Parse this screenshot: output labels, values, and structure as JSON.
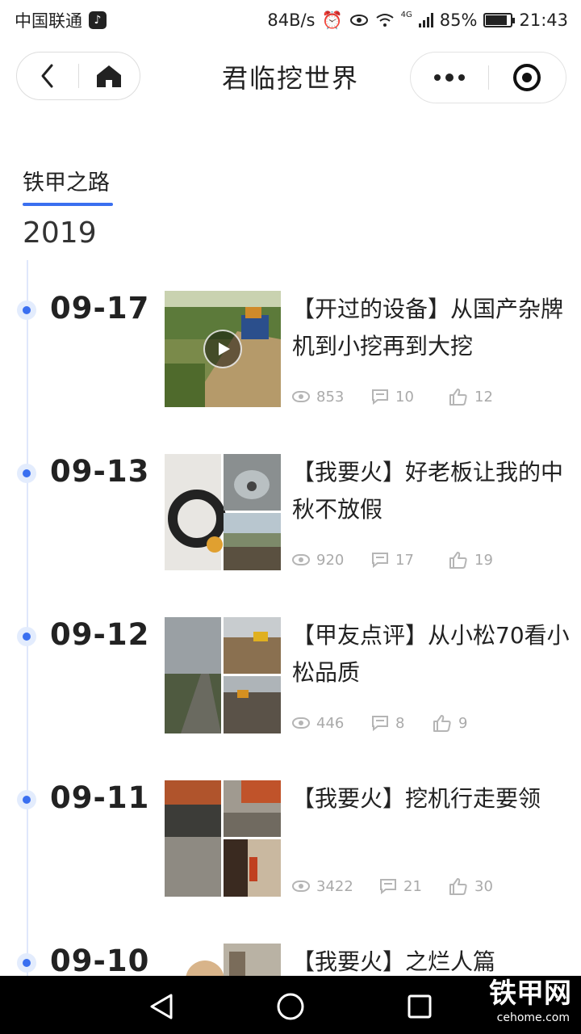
{
  "status_bar": {
    "carrier": "中国联通",
    "net_speed": "84B/s",
    "network": "4G",
    "battery": "85%",
    "battery_level": 0.85,
    "time": "21:43"
  },
  "nav": {
    "title": "君临挖世界"
  },
  "tabs": [
    {
      "label": "铁甲之路",
      "active": true
    }
  ],
  "year": "2019",
  "entries": [
    {
      "date": "09-17",
      "title": "【开过的设备】从国产杂牌机到小挖再到大挖",
      "views": "853",
      "comments": "10",
      "likes": "12",
      "has_video": true
    },
    {
      "date": "09-13",
      "title": "【我要火】好老板让我的中秋不放假",
      "views": "920",
      "comments": "17",
      "likes": "19",
      "has_video": false
    },
    {
      "date": "09-12",
      "title": "【甲友点评】从小松70看小松品质",
      "views": "446",
      "comments": "8",
      "likes": "9",
      "has_video": false
    },
    {
      "date": "09-11",
      "title": "【我要火】挖机行走要领",
      "views": "3422",
      "comments": "21",
      "likes": "30",
      "has_video": false
    },
    {
      "date": "09-10",
      "title": "【我要火】之烂人篇",
      "views": "",
      "comments": "",
      "likes": "",
      "has_video": false
    }
  ],
  "watermark": {
    "text": "铁甲网",
    "sub": "cehome.com"
  },
  "colors": {
    "accent": "#3a6ff0",
    "timeline": "#dfe7fb"
  }
}
